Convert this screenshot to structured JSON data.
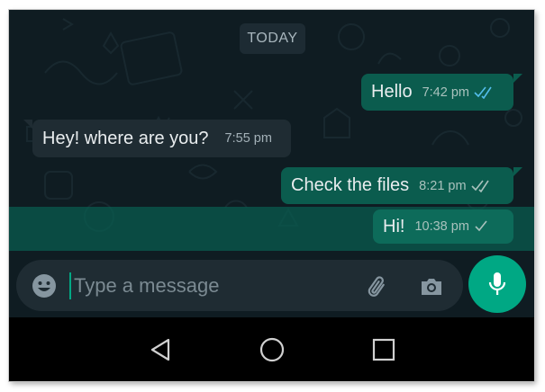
{
  "chat": {
    "date_divider": "TODAY",
    "messages": [
      {
        "direction": "outgoing",
        "text": "Hello",
        "time": "7:42 pm",
        "status": "read"
      },
      {
        "direction": "incoming",
        "text": "Hey! where are you?",
        "time": "7:55 pm"
      },
      {
        "direction": "outgoing",
        "text": "Check the files",
        "time": "8:21 pm",
        "status": "delivered"
      },
      {
        "direction": "outgoing",
        "text": "Hi!",
        "time": "10:38 pm",
        "status": "sent",
        "highlighted": true
      }
    ]
  },
  "composer": {
    "placeholder": "Type a message",
    "emoji_icon": "emoji-icon",
    "attach_icon": "paperclip-icon",
    "camera_icon": "camera-icon",
    "mic_icon": "microphone-icon"
  },
  "navigation": {
    "back_icon": "back-triangle-icon",
    "home_icon": "home-circle-icon",
    "recents_icon": "recents-square-icon"
  },
  "colors": {
    "outgoing_bubble": "#0b5c4e",
    "incoming_bubble": "#1f2c33",
    "accent": "#00a884",
    "read_ticks": "#53bdeb",
    "background": "#0f1c22"
  }
}
